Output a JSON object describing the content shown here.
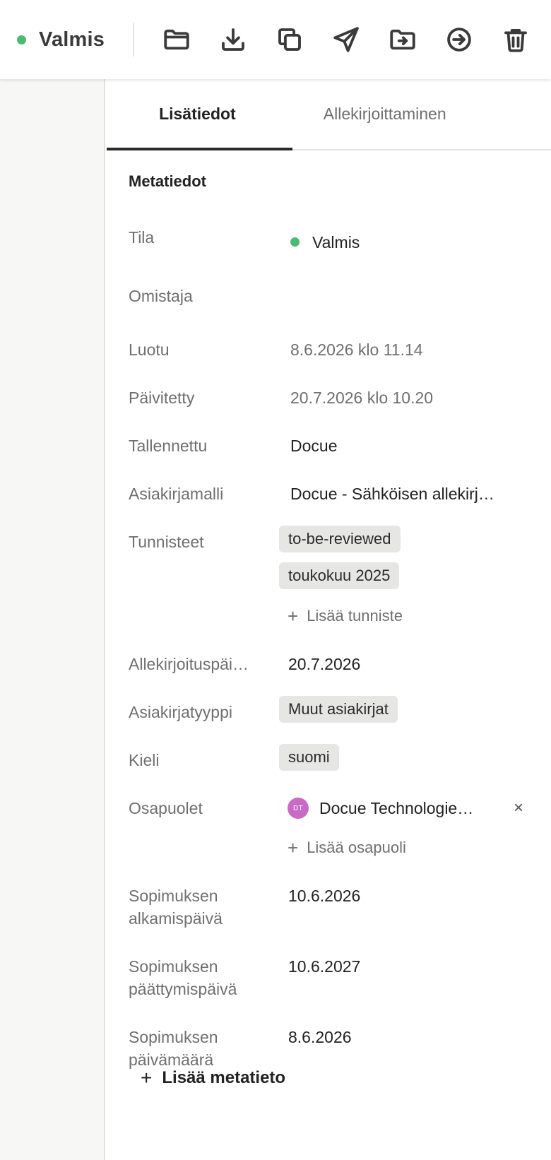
{
  "topbar": {
    "status_label": "Valmis",
    "status_color": "#4cbb72",
    "tools": [
      {
        "icon": "folder-icon"
      },
      {
        "icon": "download-icon"
      },
      {
        "icon": "copy-icon"
      },
      {
        "icon": "send-icon"
      },
      {
        "icon": "move-to-folder-icon"
      },
      {
        "icon": "sign-in-icon"
      },
      {
        "icon": "trash-icon"
      }
    ]
  },
  "tabs": [
    {
      "label": "Lisätiedot",
      "active": true
    },
    {
      "label": "Allekirjoittaminen",
      "active": false
    }
  ],
  "metadata": {
    "title": "Metatiedot",
    "status": {
      "label": "Tila",
      "value": "Valmis"
    },
    "owner": {
      "label": "Omistaja",
      "value": ""
    },
    "created": {
      "label": "Luotu",
      "value": "8.6.2026 klo 11.14"
    },
    "updated": {
      "label": "Päivitetty",
      "value": "20.7.2026 klo 10.20"
    },
    "saved": {
      "label": "Tallennettu",
      "value": "Docue"
    },
    "template": {
      "label": "Asiakirjamalli",
      "value": "Docue - Sähköisen allekirj…"
    },
    "tags": {
      "label": "Tunnisteet",
      "items": [
        "to-be-reviewed",
        "toukokuu 2025"
      ],
      "add_label": "Lisää tunniste"
    },
    "signing_date": {
      "label": "Allekirjoituspäi…",
      "value": "20.7.2026"
    },
    "doc_type": {
      "label": "Asiakirjatyyppi",
      "value": "Muut asiakirjat"
    },
    "language": {
      "label": "Kieli",
      "value": "suomi"
    },
    "parties": {
      "label": "Osapuolet",
      "items": [
        {
          "initials": "DT",
          "name": "Docue Technologie…"
        }
      ],
      "add_label": "Lisää osapuoli",
      "remove_label": "×"
    },
    "start_date": {
      "label_1": "Sopimuksen",
      "label_2": "alkamispäivä",
      "value": "10.6.2026"
    },
    "end_date": {
      "label_1": "Sopimuksen",
      "label_2": "päättymispäivä",
      "value": "10.6.2027"
    },
    "contract_date": {
      "label_1": "Sopimuksen",
      "label_2": "päivämäärä",
      "value": "8.6.2026"
    },
    "add_metadata_label": "Lisää metatieto"
  }
}
